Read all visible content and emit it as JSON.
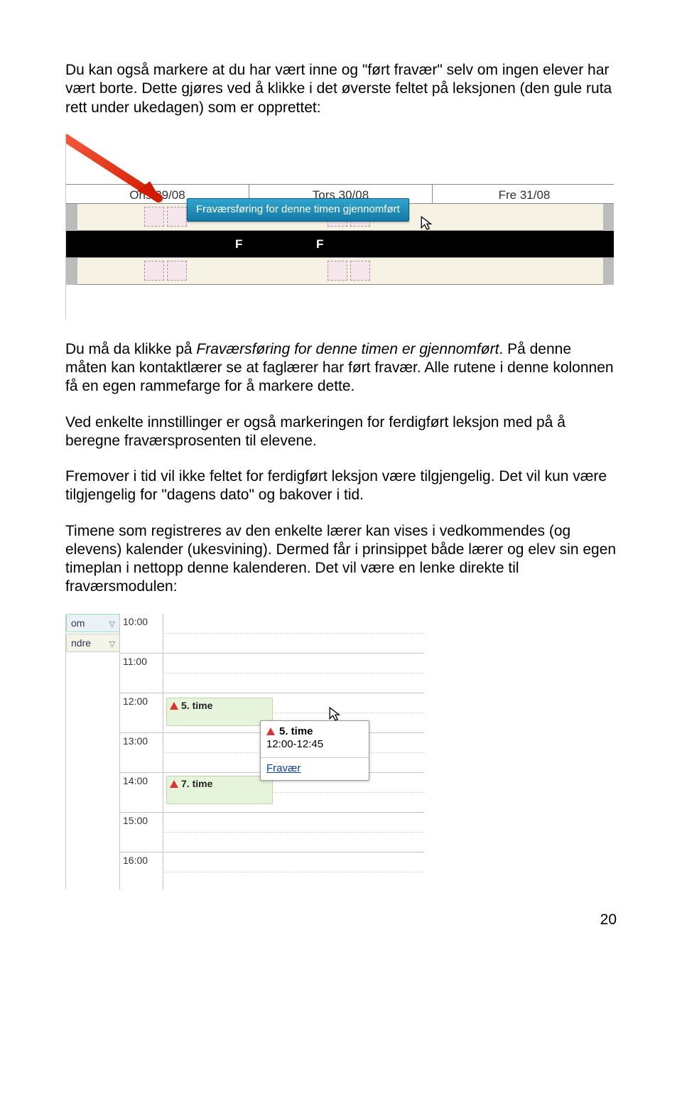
{
  "paragraphs": {
    "p1": "Du kan også markere at du har vært inne og \"ført fravær\" selv om ingen elever har vært borte. Dette gjøres ved å klikke i det øverste feltet på leksjonen (den gule ruta rett under ukedagen) som er opprettet:",
    "p2_a": "Du må da klikke på ",
    "p2_em": "Fraværsføring for denne timen er gjennomført",
    "p2_b": ". På denne måten kan kontaktlærer se at faglærer har ført fravær. Alle rutene i denne kolonnen få en egen rammefarge for å markere dette.",
    "p3": "Ved enkelte innstillinger er også markeringen for ferdigført leksjon med på å beregne fraværsprosenten til elevene.",
    "p4": "Fremover i tid vil ikke feltet for ferdigført leksjon være tilgjengelig. Det vil kun være tilgjengelig for \"dagens dato\" og bakover i tid.",
    "p5": "Timene som registreres av den enkelte lærer kan vises i vedkommendes (og elevens) kalender (ukesvining). Dermed får i prinsippet både lærer og elev sin egen timeplan i nettopp denne kalenderen. Det vil være en lenke direkte til fraværsmodulen:"
  },
  "fig1": {
    "day1": "Ons 29/08",
    "day2": "Tors 30/08",
    "day3": "Fre 31/08",
    "f": "F",
    "tooltip": "Fraværsføring for denne timen gjennomført"
  },
  "fig2": {
    "sb1": "om",
    "sb2": "ndre",
    "times": [
      "10:00",
      "11:00",
      "12:00",
      "13:00",
      "14:00",
      "15:00",
      "16:00"
    ],
    "event1": "5. time",
    "popup_title": "5. time",
    "popup_time": "12:00-12:45",
    "popup_link": "Fravær",
    "event2": "7. time"
  },
  "page": "20"
}
